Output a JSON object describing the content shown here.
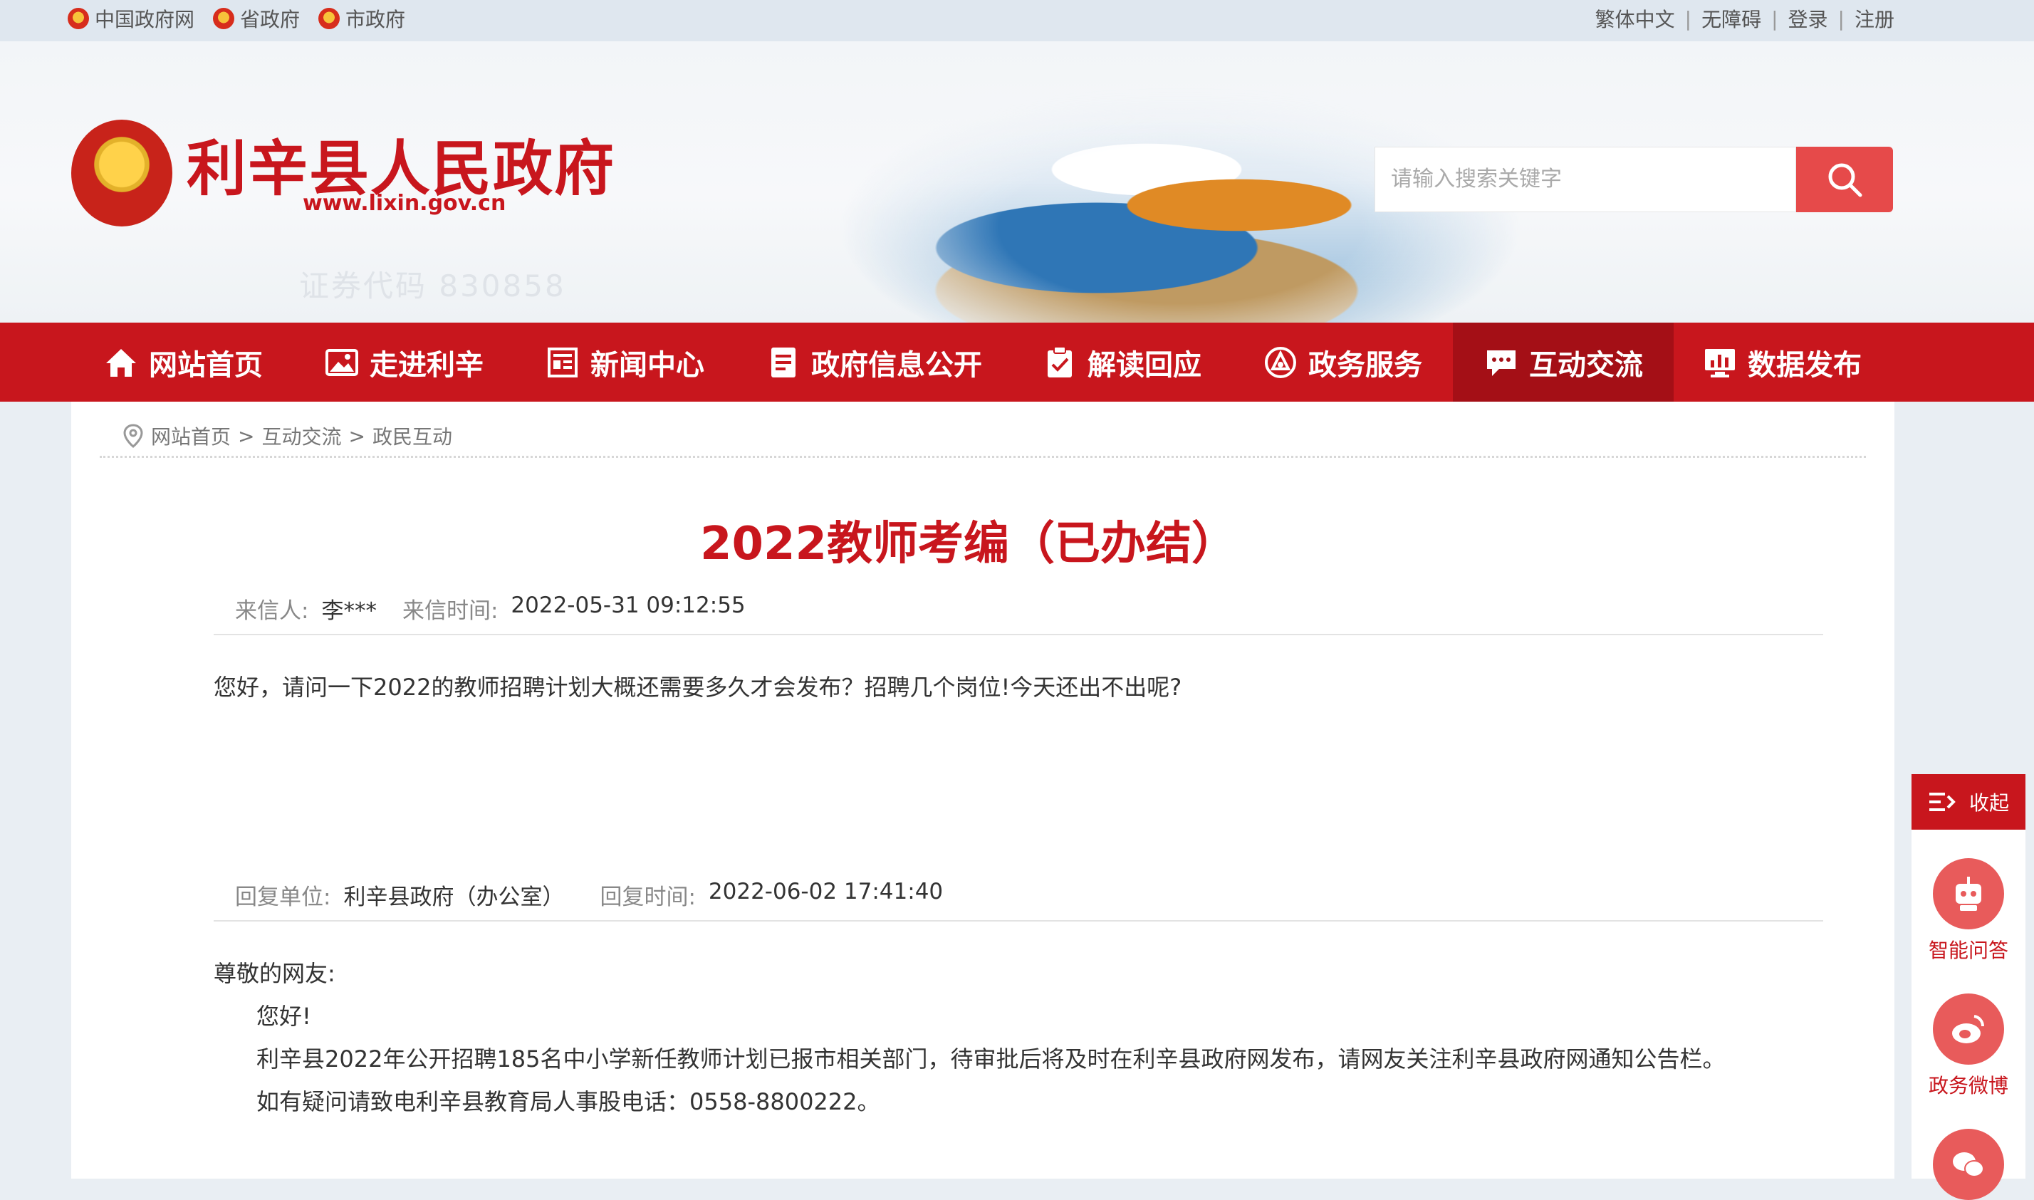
{
  "toplinks": {
    "left": [
      "中国政府网",
      "省政府",
      "市政府"
    ],
    "right": [
      "繁体中文",
      "无障碍",
      "登录",
      "注册"
    ],
    "sep": "|"
  },
  "header": {
    "title": "利辛县人民政府",
    "url": "www.lixin.gov.cn",
    "watermark_code": "证券代码 830858",
    "search_placeholder": "请输入搜索关键字"
  },
  "nav": {
    "items": [
      {
        "label": "网站首页",
        "icon": "home-icon"
      },
      {
        "label": "走进利辛",
        "icon": "picture-icon"
      },
      {
        "label": "新闻中心",
        "icon": "news-icon"
      },
      {
        "label": "政府信息公开",
        "icon": "document-icon"
      },
      {
        "label": "解读回应",
        "icon": "clipboard-check-icon"
      },
      {
        "label": "政务服务",
        "icon": "service-icon"
      },
      {
        "label": "互动交流",
        "icon": "chat-icon"
      },
      {
        "label": "数据发布",
        "icon": "data-monitor-icon"
      }
    ],
    "active_index": 6
  },
  "breadcrumb": {
    "items": [
      "网站首页",
      "互动交流",
      "政民互动"
    ],
    "sep": ">"
  },
  "letter": {
    "title": "2022教师考编（已办结）",
    "sender_label": "来信人:",
    "sender": "李***",
    "time_label": "来信时间:",
    "time": "2022-05-31 09:12:55",
    "question": "您好，请问一下2022的教师招聘计划大概还需要多久才会发布？招聘几个岗位!今天还出不出呢?"
  },
  "reply": {
    "unit_label": "回复单位:",
    "unit": "利辛县政府（办公室）",
    "time_label": "回复时间:",
    "time": "2022-06-02 17:41:40",
    "salutation": "尊敬的网友:",
    "greeting": "您好!",
    "para1": "利辛县2022年公开招聘185名中小学新任教师计划已报市相关部门，待审批后将及时在利辛县政府网发布，请网友关注利辛县政府网通知公告栏。",
    "para2": "如有疑问请致电利辛县教育局人事股电话：0558-8800222。"
  },
  "float": {
    "toggle_label": "收起",
    "items": [
      {
        "label": "智能问答",
        "icon": "robot-icon"
      },
      {
        "label": "政务微博",
        "icon": "weibo-icon"
      },
      {
        "label": "",
        "icon": "wechat-icon"
      }
    ]
  },
  "colors": {
    "brand_red": "#c8161d",
    "nav_active": "#a40f16",
    "search_btn": "#e64a4a"
  }
}
